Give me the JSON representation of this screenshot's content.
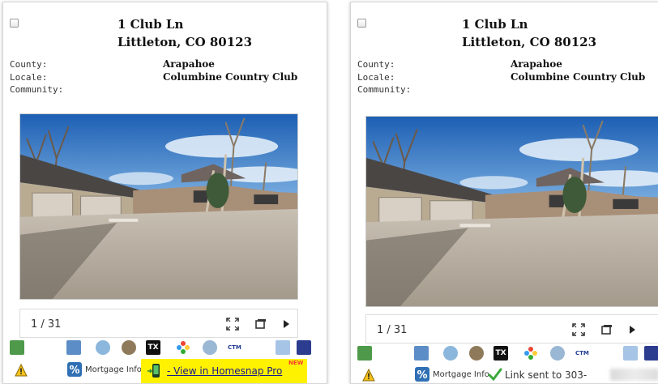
{
  "cards": [
    {
      "address_line1": "1 Club Ln",
      "address_line2": "Littleton, CO 80123",
      "labels": {
        "county": "County:",
        "locale": "Locale:",
        "community": "Community:"
      },
      "values": {
        "county": "Arapahoe",
        "locale": "Columbine Country Club",
        "community": ""
      },
      "pager": {
        "count": "1 / 31"
      },
      "mortgage_label": "Mortgage Info",
      "homesnap_link": "- View in Homesnap Pro",
      "homesnap_badge": "NEW"
    },
    {
      "address_line1": "1 Club Ln",
      "address_line2": "Littleton, CO 80123",
      "labels": {
        "county": "County:",
        "locale": "Locale:",
        "community": "Community:"
      },
      "values": {
        "county": "Arapahoe",
        "locale": "Columbine Country Club",
        "community": ""
      },
      "pager": {
        "count": "1 / 31"
      },
      "mortgage_label": "Mortgage Info",
      "status_text": "Link sent to 303-"
    }
  ],
  "toolbar_icons": [
    "map-icon",
    "photo-icon",
    "clock-icon",
    "film-icon",
    "tx-icon",
    "pinwheel-icon",
    "globe-icon",
    "ctm-icon",
    "copy-icon",
    "book-icon"
  ],
  "colors": {
    "highlight": "#fff200",
    "link": "#1a1a8a",
    "new_badge": "#ff3b2f",
    "check": "#3aa83a"
  }
}
